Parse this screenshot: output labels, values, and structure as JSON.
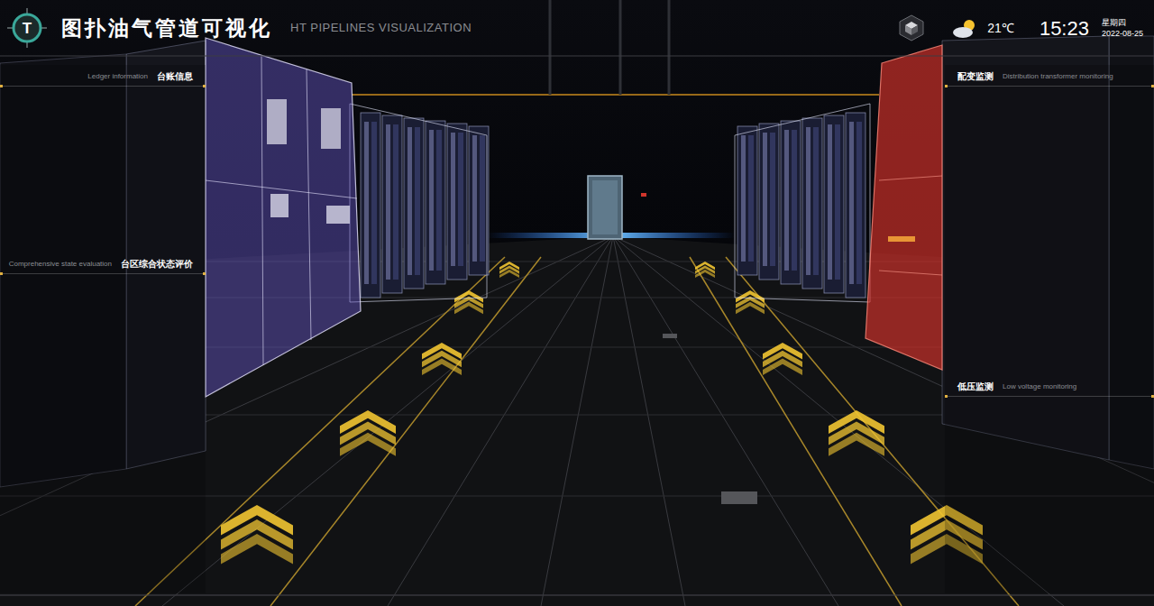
{
  "header": {
    "logo": "T",
    "title": "图扑油气管道可视化",
    "subtitle": "HT PIPELINES VISUALIZATION",
    "temperature": "21℃",
    "time": "15:23",
    "weekday": "星期四",
    "date": "2022-08-25"
  },
  "left_panels": [
    {
      "title": "台账信息",
      "subtitle": "Ledger information"
    },
    {
      "title": "台区综合状态评价",
      "subtitle": "Comprehensive state evaluation"
    }
  ],
  "right_panels": [
    {
      "title": "配变监测",
      "subtitle": "Distribution transformer monitoring"
    },
    {
      "title": "低压监测",
      "subtitle": "Low voltage monitoring"
    }
  ],
  "highlighted_cabinets": [
    {
      "side": "left",
      "color": "#6a5acd"
    },
    {
      "side": "right",
      "color": "#d9322b"
    }
  ]
}
